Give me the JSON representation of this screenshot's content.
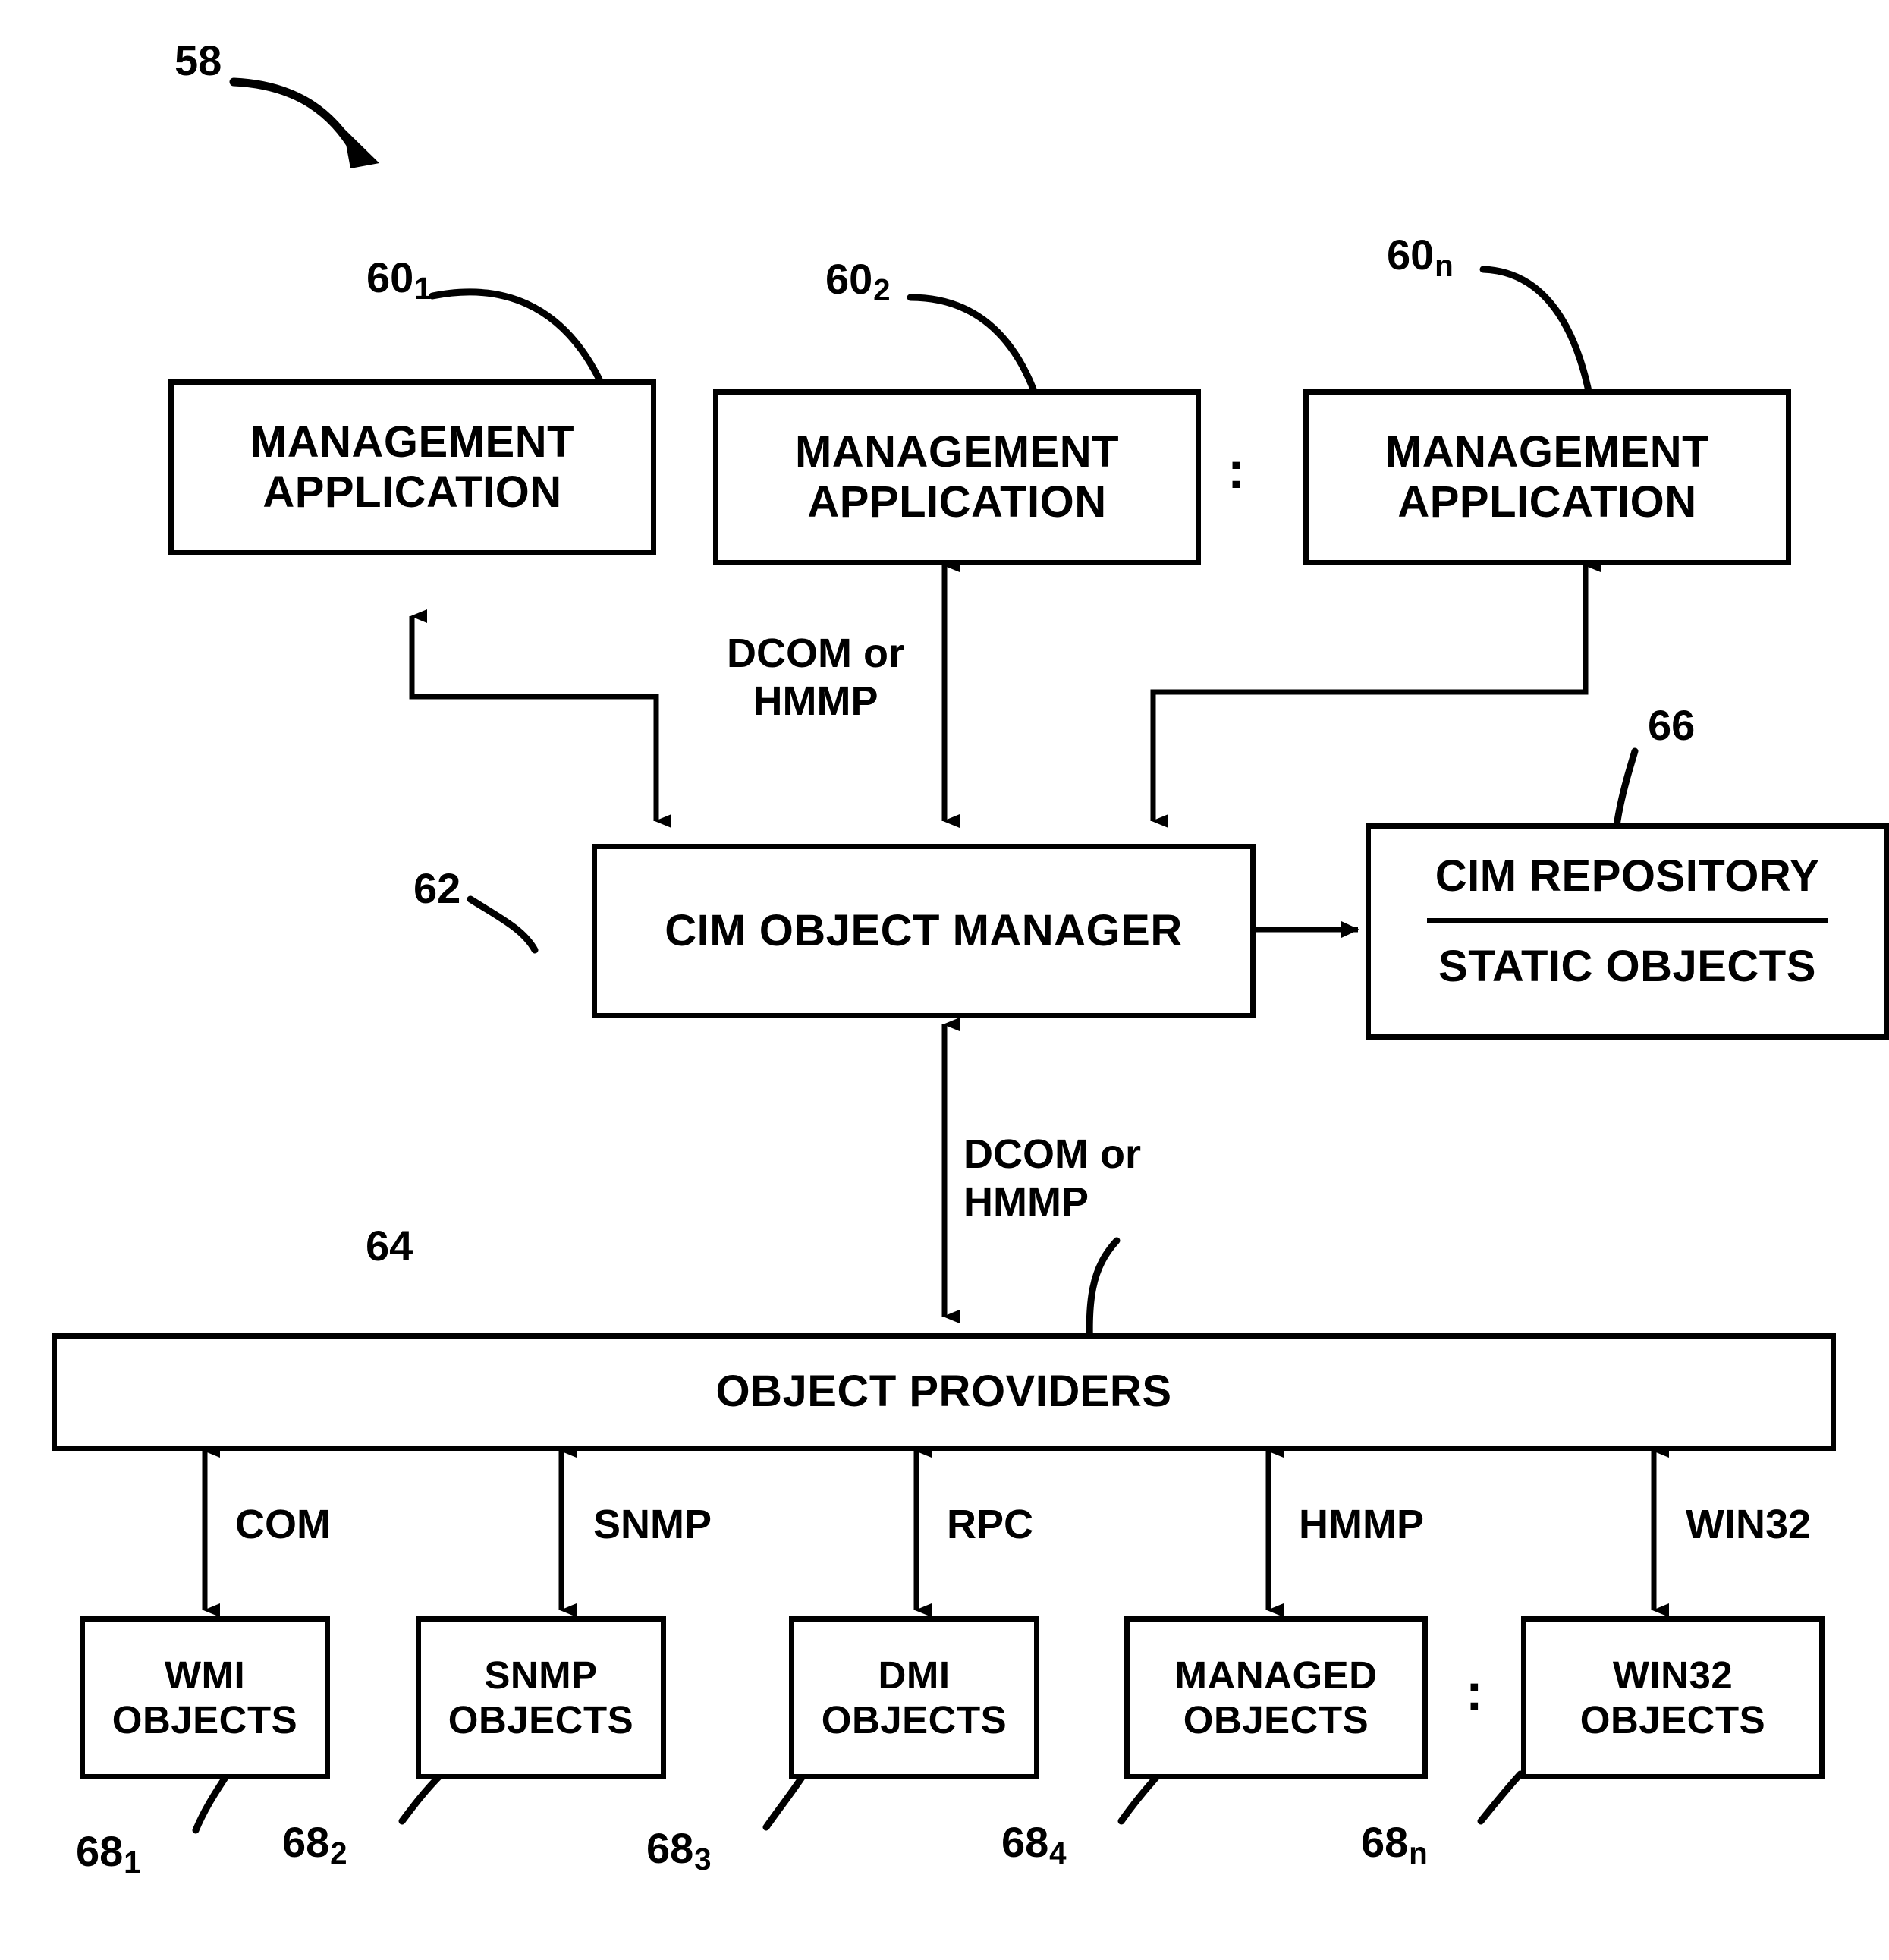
{
  "figure": {
    "ref_main": "58",
    "ellipsis_glyph": ":"
  },
  "management_apps": [
    {
      "ref": "60",
      "sub": "1",
      "line1": "MANAGEMENT",
      "line2": "APPLICATION"
    },
    {
      "ref": "60",
      "sub": "2",
      "line1": "MANAGEMENT",
      "line2": "APPLICATION"
    },
    {
      "ref": "60",
      "sub": "n",
      "line1": "MANAGEMENT",
      "line2": "APPLICATION"
    }
  ],
  "object_manager": {
    "ref": "62",
    "label": "CIM OBJECT MANAGER"
  },
  "repository": {
    "ref": "66",
    "line1": "CIM REPOSITORY",
    "line2": "STATIC OBJECTS"
  },
  "providers": {
    "ref": "64",
    "label": "OBJECT PROVIDERS"
  },
  "edge_labels": {
    "apps_to_manager": "DCOM or\nHMMP",
    "apps_to_manager_line1": "DCOM or",
    "apps_to_manager_line2": "HMMP",
    "manager_to_providers_line1": "DCOM or",
    "manager_to_providers_line2": "HMMP",
    "manager_repository": ""
  },
  "provider_links": [
    {
      "protocol": "COM"
    },
    {
      "protocol": "SNMP"
    },
    {
      "protocol": "RPC"
    },
    {
      "protocol": "HMMP"
    },
    {
      "protocol": "WIN32"
    }
  ],
  "managed_objects": [
    {
      "ref": "68",
      "sub": "1",
      "line1": "WMI",
      "line2": "OBJECTS"
    },
    {
      "ref": "68",
      "sub": "2",
      "line1": "SNMP",
      "line2": "OBJECTS"
    },
    {
      "ref": "68",
      "sub": "3",
      "line1": "DMI",
      "line2": "OBJECTS"
    },
    {
      "ref": "68",
      "sub": "4",
      "line1": "MANAGED",
      "line2": "OBJECTS"
    },
    {
      "ref": "68",
      "sub": "n",
      "line1": "WIN32",
      "line2": "OBJECTS"
    }
  ],
  "colors": {
    "stroke": "#000000",
    "background": "#ffffff"
  }
}
